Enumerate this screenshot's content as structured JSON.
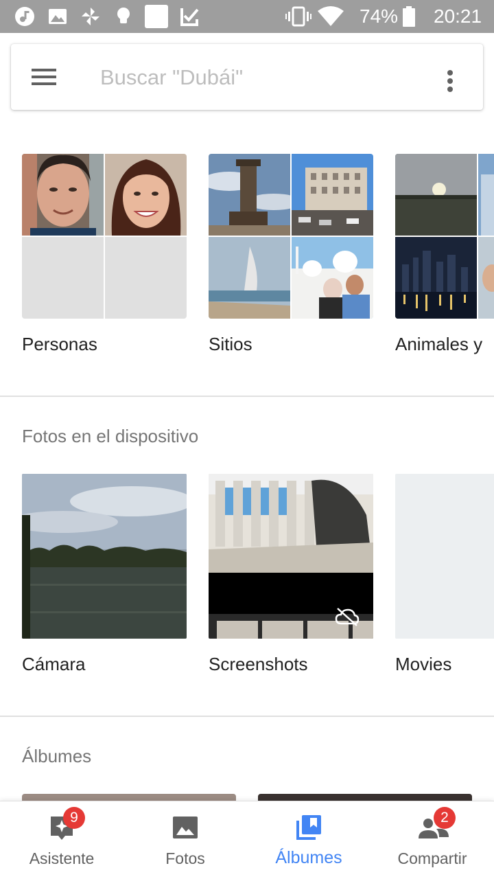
{
  "status_bar": {
    "battery": "74%",
    "time": "20:21",
    "left_icons": [
      "music-note-icon",
      "image-icon",
      "pinwheel-icon",
      "lightbulb-icon",
      "square-icon",
      "checkbox-icon"
    ],
    "right_icons": [
      "vibrate-icon",
      "wifi-icon",
      "battery-icon"
    ]
  },
  "search": {
    "placeholder": "Buscar \"Dubái\""
  },
  "top_section": {
    "tiles": [
      {
        "label": "Personas"
      },
      {
        "label": "Sitios"
      },
      {
        "label": "Animales y"
      }
    ]
  },
  "device_section": {
    "title": "Fotos en el dispositivo",
    "tiles": [
      {
        "label": "Cámara"
      },
      {
        "label": "Screenshots",
        "icon": "cloud-off-icon"
      },
      {
        "label": "Movies"
      }
    ]
  },
  "albums_section": {
    "title": "Álbumes"
  },
  "bottom_nav": {
    "items": [
      {
        "label": "Asistente",
        "badge": "9",
        "icon": "assistant-icon"
      },
      {
        "label": "Fotos",
        "icon": "photo-icon"
      },
      {
        "label": "Álbumes",
        "icon": "albums-icon",
        "active": true
      },
      {
        "label": "Compartir",
        "badge": "2",
        "icon": "people-icon"
      }
    ]
  },
  "colors": {
    "accent": "#4285f4",
    "badge": "#e53935",
    "status_bar": "#9e9e9e"
  }
}
